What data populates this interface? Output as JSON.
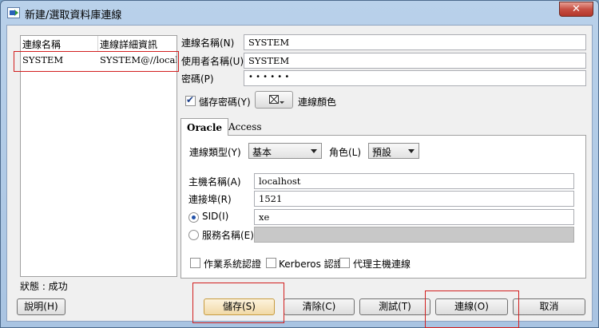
{
  "window": {
    "title": "新建/選取資料庫連線",
    "close_glyph": "✕"
  },
  "connection_list": {
    "columns": [
      "連線名稱",
      "連線詳細資訊"
    ],
    "rows": [
      {
        "name": "SYSTEM",
        "details": "SYSTEM@//local..."
      }
    ]
  },
  "form": {
    "connection_name_label": "連線名稱(N)",
    "connection_name_value": "SYSTEM",
    "username_label": "使用者名稱(U)",
    "username_value": "SYSTEM",
    "password_label": "密碼(P)",
    "password_value": "• • • • • •",
    "save_password_label": "儲存密碼(Y)",
    "save_password_checked": true,
    "connection_color_label": "連線顏色"
  },
  "tabs": [
    {
      "label": "Oracle",
      "active": true
    },
    {
      "label": "Access",
      "active": false
    }
  ],
  "oracle": {
    "connection_type_label": "連線類型(Y)",
    "connection_type_value": "基本",
    "role_label": "角色(L)",
    "role_value": "預設",
    "hostname_label": "主機名稱(A)",
    "hostname_value": "localhost",
    "port_label": "連接埠(R)",
    "port_value": "1521",
    "sid_label": "SID(I)",
    "sid_value": "xe",
    "sid_selected": true,
    "service_name_label": "服務名稱(E)",
    "service_name_value": "",
    "os_auth_label": "作業系統認證",
    "kerberos_label": "Kerberos 認證",
    "proxy_label": "代理主機連線"
  },
  "status": {
    "text": "狀態 : 成功"
  },
  "buttons": {
    "help": "說明(H)",
    "save": "儲存(S)",
    "clear": "清除(C)",
    "test": "測試(T)",
    "connect": "連線(O)",
    "cancel": "取消"
  },
  "colors": {
    "highlight_box": "#d21f1f",
    "title_bar": "#b9d1ea"
  }
}
